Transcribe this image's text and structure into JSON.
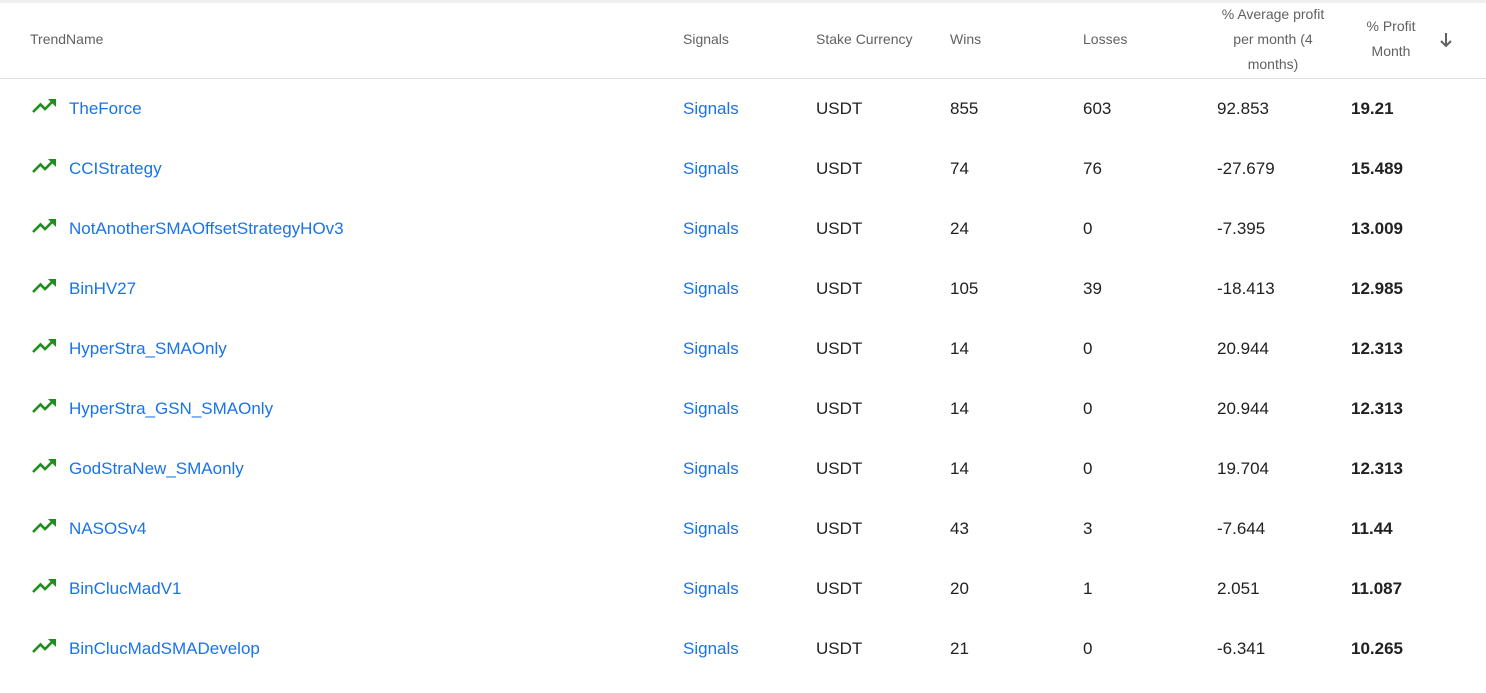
{
  "columns": {
    "trend_name": "TrendName",
    "signals": "Signals",
    "stake_currency": "Stake Currency",
    "wins": "Wins",
    "losses": "Losses",
    "avg_profit_line1": "% Average profit",
    "avg_profit_line2": "per month (4",
    "avg_profit_line3": "months)",
    "profit_month_line1": "% Profit",
    "profit_month_line2": "Month"
  },
  "sort": {
    "column": "profit_month",
    "direction": "desc",
    "icon": "arrow-down-icon"
  },
  "colors": {
    "link": "#1a73e8",
    "trend_icon": "#1e8e1e",
    "header_text": "#616161"
  },
  "rows": [
    {
      "name": "TheForce",
      "signals": "Signals",
      "currency": "USDT",
      "wins": "855",
      "losses": "603",
      "avg_profit": "92.853",
      "profit_month": "19.21"
    },
    {
      "name": "CCIStrategy",
      "signals": "Signals",
      "currency": "USDT",
      "wins": "74",
      "losses": "76",
      "avg_profit": "-27.679",
      "profit_month": "15.489"
    },
    {
      "name": "NotAnotherSMAOffsetStrategyHOv3",
      "signals": "Signals",
      "currency": "USDT",
      "wins": "24",
      "losses": "0",
      "avg_profit": "-7.395",
      "profit_month": "13.009"
    },
    {
      "name": "BinHV27",
      "signals": "Signals",
      "currency": "USDT",
      "wins": "105",
      "losses": "39",
      "avg_profit": "-18.413",
      "profit_month": "12.985"
    },
    {
      "name": "HyperStra_SMAOnly",
      "signals": "Signals",
      "currency": "USDT",
      "wins": "14",
      "losses": "0",
      "avg_profit": "20.944",
      "profit_month": "12.313"
    },
    {
      "name": "HyperStra_GSN_SMAOnly",
      "signals": "Signals",
      "currency": "USDT",
      "wins": "14",
      "losses": "0",
      "avg_profit": "20.944",
      "profit_month": "12.313"
    },
    {
      "name": "GodStraNew_SMAonly",
      "signals": "Signals",
      "currency": "USDT",
      "wins": "14",
      "losses": "0",
      "avg_profit": "19.704",
      "profit_month": "12.313"
    },
    {
      "name": "NASOSv4",
      "signals": "Signals",
      "currency": "USDT",
      "wins": "43",
      "losses": "3",
      "avg_profit": "-7.644",
      "profit_month": "11.44"
    },
    {
      "name": "BinClucMadV1",
      "signals": "Signals",
      "currency": "USDT",
      "wins": "20",
      "losses": "1",
      "avg_profit": "2.051",
      "profit_month": "11.087"
    },
    {
      "name": "BinClucMadSMADevelop",
      "signals": "Signals",
      "currency": "USDT",
      "wins": "21",
      "losses": "0",
      "avg_profit": "-6.341",
      "profit_month": "10.265"
    }
  ]
}
